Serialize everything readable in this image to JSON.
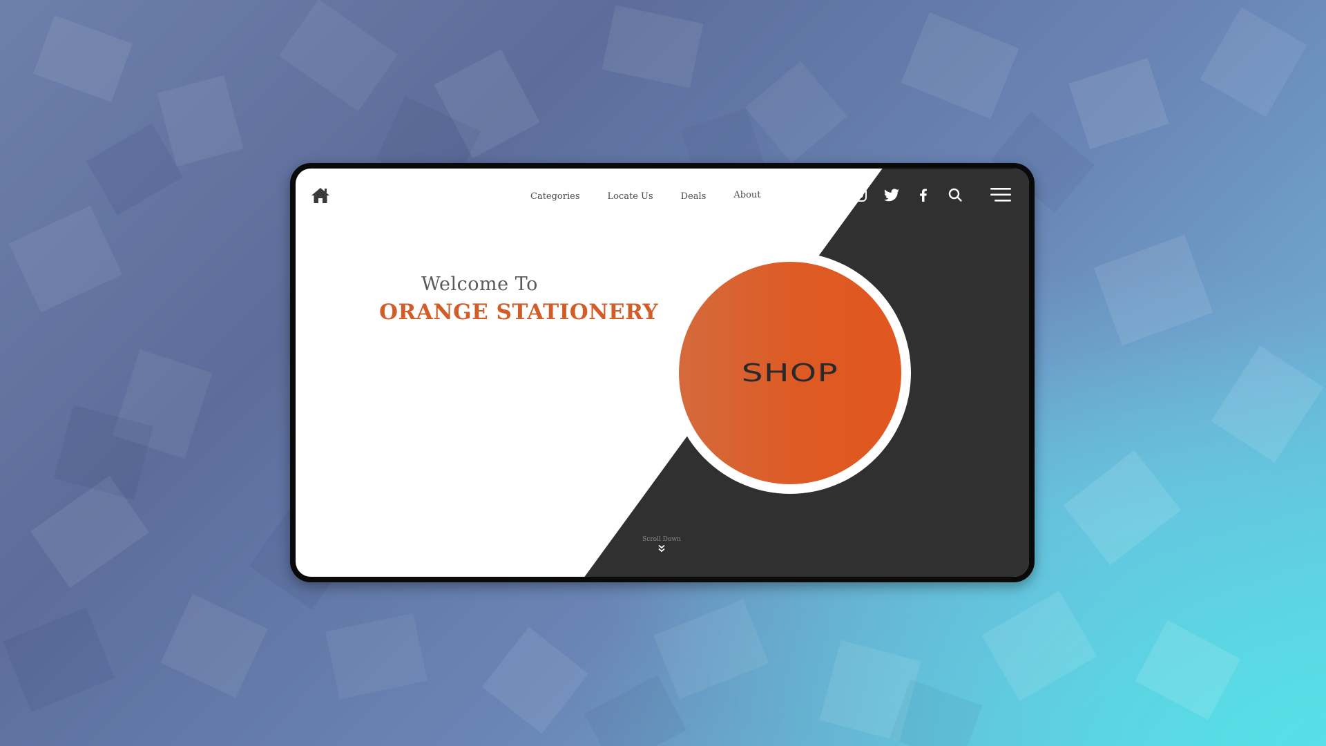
{
  "nav": {
    "home_icon": "home-icon",
    "links": [
      "Categories",
      "Locate Us",
      "Deals",
      "About"
    ],
    "social_icons": [
      "instagram-icon",
      "twitter-icon",
      "facebook-icon",
      "search-icon"
    ],
    "menu_icon": "hamburger-menu-icon"
  },
  "hero": {
    "welcome": "Welcome To",
    "brand": "ORANGE STATIONERY",
    "shop_label": "SHOP",
    "scroll_label": "Scroll Down",
    "scroll_icon": "chevron-double-down-icon"
  },
  "colors": {
    "accent": "#d25d28",
    "dark_panel": "#303030",
    "shop_gradient_start": "#d46a3c",
    "shop_gradient_end": "#e1571f",
    "frame": "#0a0a0a"
  }
}
